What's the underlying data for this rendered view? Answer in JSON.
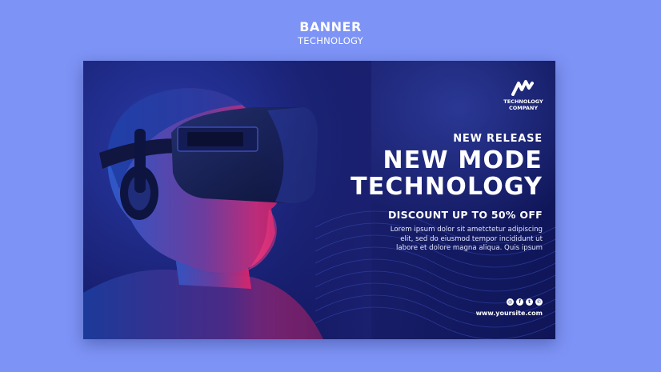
{
  "header": {
    "title": "BANNER",
    "subtitle": "TECHNOLOGY"
  },
  "banner": {
    "logo": {
      "icon": "wave-logo-icon",
      "line1": "TECHNOLOGY",
      "line2": "COMPANY"
    },
    "kicker": "NEW RELEASE",
    "headline_1": "NEW MODE",
    "headline_2": "TECHNOLOGY",
    "discount": "DISCOUNT UP TO 50% OFF",
    "body_lines": [
      "Lorem ipsum dolor sit ametctetur adipiscing",
      "elit, sed do eiusmod tempor incididunt ut",
      "labore et dolore magna aliqua. Quis ipsum"
    ],
    "social_icons": [
      "instagram-icon",
      "facebook-icon",
      "twitter-icon",
      "whatsapp-icon"
    ],
    "website": "www.yoursite.com",
    "colors": {
      "page_bg": "#7d93f5",
      "banner_bg": "#1b2170",
      "accent_pink": "#e0246a",
      "accent_blue": "#3b6cff"
    }
  }
}
